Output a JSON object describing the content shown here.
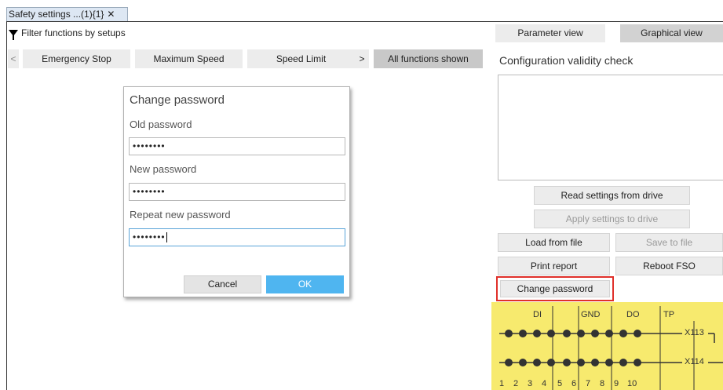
{
  "tab": {
    "title": "Safety settings ...(1){1}",
    "close": "✕"
  },
  "filter": {
    "label": "Filter functions by setups",
    "icon": "filter-funnel"
  },
  "function_bar": {
    "prev": "<",
    "items": [
      "Emergency Stop",
      "Maximum Speed",
      "Speed Limit"
    ],
    "next": ">",
    "all": "All functions shown"
  },
  "dialog": {
    "title": "Change password",
    "old_label": "Old password",
    "old_value": "••••••••",
    "new_label": "New password",
    "new_value": "••••••••",
    "repeat_label": "Repeat new password",
    "repeat_value": "••••••••",
    "cancel": "Cancel",
    "ok": "OK"
  },
  "right": {
    "parameter_view": "Parameter view",
    "graphical_view": "Graphical view",
    "config_check": "Configuration validity check",
    "read_settings": "Read settings from drive",
    "apply_settings": "Apply settings to drive",
    "load_file": "Load from file",
    "save_file": "Save to file",
    "print_report": "Print report",
    "reboot": "Reboot FSO",
    "change_password": "Change password"
  },
  "terminal": {
    "groups": [
      "DI",
      "GND",
      "DO",
      "TP"
    ],
    "rows": [
      "X113",
      "X114"
    ],
    "pins": [
      "1",
      "2",
      "3",
      "4",
      "5",
      "6",
      "7",
      "8",
      "9",
      "10"
    ],
    "colors": {
      "panel": "#f7ea6e",
      "dot": "#333333"
    }
  },
  "colors": {
    "ok_button": "#4fb5f0",
    "highlight": "#e0302a",
    "tab": "#dde7f3"
  }
}
